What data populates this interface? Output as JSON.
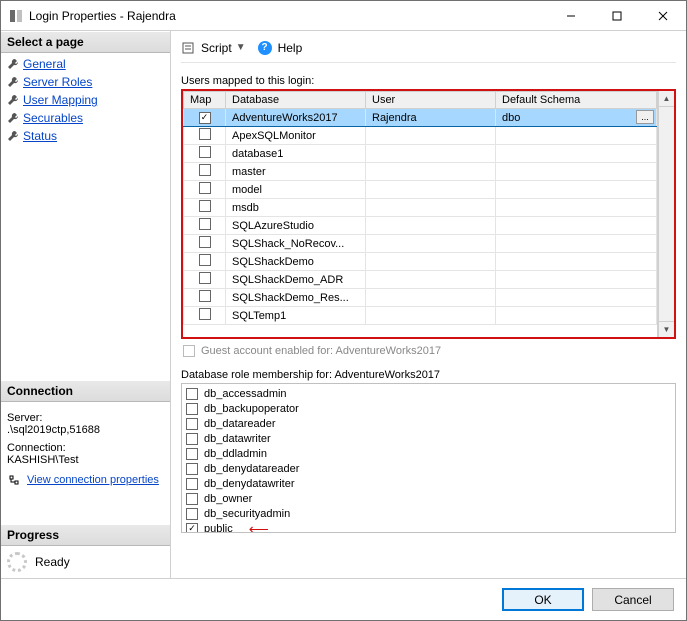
{
  "window": {
    "title": "Login Properties - Rajendra"
  },
  "toolbar": {
    "script_label": "Script",
    "help_label": "Help"
  },
  "left": {
    "select_page_header": "Select a page",
    "pages": [
      "General",
      "Server Roles",
      "User Mapping",
      "Securables",
      "Status"
    ],
    "connection_header": "Connection",
    "server_label": "Server:",
    "server_value": ".\\sql2019ctp,51688",
    "connection_label": "Connection:",
    "connection_value": "KASHISH\\Test",
    "view_props_link": "View connection properties",
    "progress_header": "Progress",
    "progress_status": "Ready"
  },
  "main": {
    "mapped_label": "Users mapped to this login:",
    "grid_headers": {
      "map": "Map",
      "database": "Database",
      "user": "User",
      "schema": "Default Schema"
    },
    "databases": [
      {
        "map": true,
        "database": "AdventureWorks2017",
        "user": "Rajendra",
        "schema": "dbo",
        "selected": true
      },
      {
        "map": false,
        "database": "ApexSQLMonitor",
        "user": "",
        "schema": ""
      },
      {
        "map": false,
        "database": "database1",
        "user": "",
        "schema": ""
      },
      {
        "map": false,
        "database": "master",
        "user": "",
        "schema": ""
      },
      {
        "map": false,
        "database": "model",
        "user": "",
        "schema": ""
      },
      {
        "map": false,
        "database": "msdb",
        "user": "",
        "schema": ""
      },
      {
        "map": false,
        "database": "SQLAzureStudio",
        "user": "",
        "schema": ""
      },
      {
        "map": false,
        "database": "SQLShack_NoRecov...",
        "user": "",
        "schema": ""
      },
      {
        "map": false,
        "database": "SQLShackDemo",
        "user": "",
        "schema": ""
      },
      {
        "map": false,
        "database": "SQLShackDemo_ADR",
        "user": "",
        "schema": ""
      },
      {
        "map": false,
        "database": "SQLShackDemo_Res...",
        "user": "",
        "schema": ""
      },
      {
        "map": false,
        "database": "SQLTemp1",
        "user": "",
        "schema": ""
      }
    ],
    "guest_label": "Guest account enabled for: AdventureWorks2017",
    "roles_label": "Database role membership for: AdventureWorks2017",
    "roles": [
      {
        "name": "db_accessadmin",
        "checked": false
      },
      {
        "name": "db_backupoperator",
        "checked": false
      },
      {
        "name": "db_datareader",
        "checked": false
      },
      {
        "name": "db_datawriter",
        "checked": false
      },
      {
        "name": "db_ddladmin",
        "checked": false
      },
      {
        "name": "db_denydatareader",
        "checked": false
      },
      {
        "name": "db_denydatawriter",
        "checked": false
      },
      {
        "name": "db_owner",
        "checked": false
      },
      {
        "name": "db_securityadmin",
        "checked": false
      },
      {
        "name": "public",
        "checked": true
      }
    ]
  },
  "buttons": {
    "ok": "OK",
    "cancel": "Cancel"
  }
}
